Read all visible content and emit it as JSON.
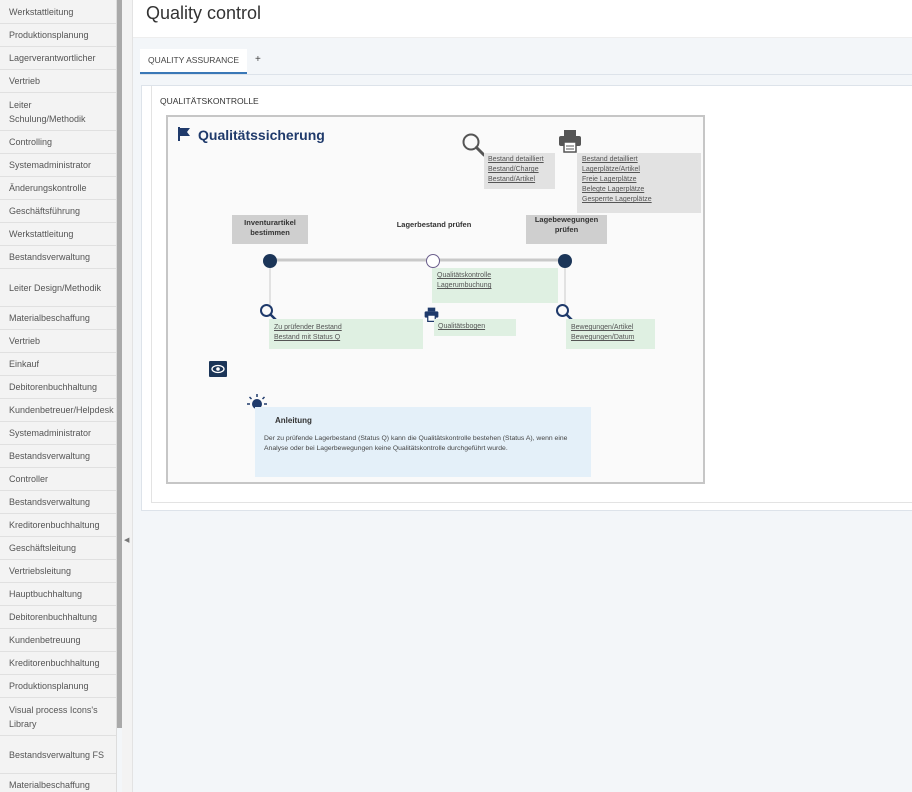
{
  "sidebar": {
    "items": [
      "Werkstattleitung",
      "Produktionsplanung",
      "Lagerverantwortlicher",
      "Vertrieb",
      "Leiter Schulung/Methodik",
      "Controlling",
      "Systemadministrator",
      "Änderungskontrolle",
      "Geschäftsführung",
      "Werkstattleitung",
      "Bestandsverwaltung",
      "Leiter Design/Methodik",
      "Materialbeschaffung",
      "Vertrieb",
      "Einkauf",
      "Debitorenbuchhaltung",
      "Kundenbetreuer/Helpdesk",
      "Systemadministrator",
      "Bestandsverwaltung",
      "Controller",
      "Bestandsverwaltung",
      "Kreditorenbuchhaltung",
      "Geschäftsleitung",
      "Vertriebsleitung",
      "Hauptbuchhaltung",
      "Debitorenbuchhaltung",
      "Kundenbetreuung",
      "Kreditorenbuchhaltung",
      "Produktionsplanung",
      "Visual process Icons's Library",
      "Bestandsverwaltung FS",
      "Materialbeschaffung"
    ]
  },
  "header": {
    "title": "Quality control"
  },
  "tabs": [
    {
      "label": "QUALITY ASSURANCE"
    },
    {
      "label": "+"
    }
  ],
  "section": {
    "title": "QUALITÄTSKONTROLLE"
  },
  "diagram": {
    "title": "Qualitätssicherung",
    "top_links_search": [
      "Bestand detailliert",
      "Bestand/Charge",
      "Bestand/Artikel"
    ],
    "top_links_print": [
      "Bestand detailliert",
      "Lagerplätze/Artikel",
      "Freie Lagerplätze",
      "Belegte Lagerplätze",
      "Gesperrte Lagerplätze"
    ],
    "steps": {
      "step1": "Inventurartikel bestimmen",
      "step2": "Lagerbestand prüfen",
      "step3": "Lagebewegungen prüfen"
    },
    "step2_links": [
      "Qualitätskontrolle",
      "Lagerumbuchung"
    ],
    "step1_links": [
      "Zu prüfender Bestand",
      "Bestand mit Status Q"
    ],
    "print_links": [
      "Qualitätsbogen"
    ],
    "step3_links": [
      "Bewegungen/Artikel",
      "Bewegungen/Datum"
    ],
    "info": {
      "title": "Anleitung",
      "text": "Der zu prüfende Lagerbestand (Status Q) kann die Qualitätskontrolle bestehen (Status A), wenn eine Analyse oder bei Lagerbewegungen keine Qualitätskontrolle durchgeführt wurde."
    }
  },
  "colors": {
    "accent": "#3a78b7",
    "node_dark": "#1b3558",
    "title_blue": "#1f3a6b",
    "green_box": "#dff0e2",
    "info_box": "#e4f0f9"
  }
}
